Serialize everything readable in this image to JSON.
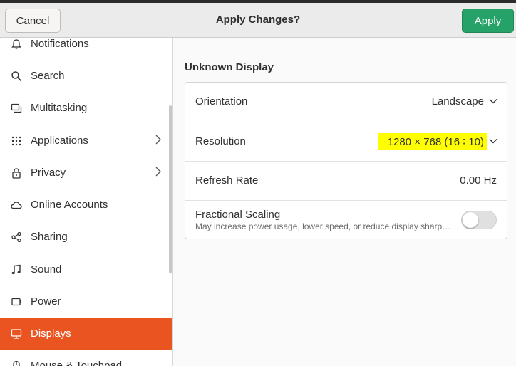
{
  "header": {
    "cancel_label": "Cancel",
    "title": "Apply Changes?",
    "apply_label": "Apply"
  },
  "sidebar": {
    "items": [
      {
        "label": "Notifications",
        "icon": "bell-icon"
      },
      {
        "label": "Search",
        "icon": "search-icon"
      },
      {
        "label": "Multitasking",
        "icon": "multitasking-icon"
      },
      {
        "label": "Applications",
        "icon": "apps-grid-icon"
      },
      {
        "label": "Privacy",
        "icon": "lock-icon"
      },
      {
        "label": "Online Accounts",
        "icon": "cloud-icon"
      },
      {
        "label": "Sharing",
        "icon": "share-icon"
      },
      {
        "label": "Sound",
        "icon": "music-note-icon"
      },
      {
        "label": "Power",
        "icon": "power-icon"
      },
      {
        "label": "Displays",
        "icon": "monitor-icon"
      },
      {
        "label": "Mouse & Touchpad",
        "icon": "mouse-icon"
      }
    ],
    "active": "Displays"
  },
  "main": {
    "section_title": "Unknown Display",
    "orientation": {
      "label": "Orientation",
      "value": "Landscape"
    },
    "resolution": {
      "label": "Resolution",
      "value": "1280 × 768 (16 ∶ 10)"
    },
    "refresh_rate": {
      "label": "Refresh Rate",
      "value": "0.00 Hz"
    },
    "fractional_scaling": {
      "label": "Fractional Scaling",
      "description": "May increase power usage, lower speed, or reduce display sharpness.",
      "enabled": false
    }
  },
  "colors": {
    "accent": "#e95420",
    "apply_green": "#26a269",
    "highlight": "#ffff00"
  }
}
